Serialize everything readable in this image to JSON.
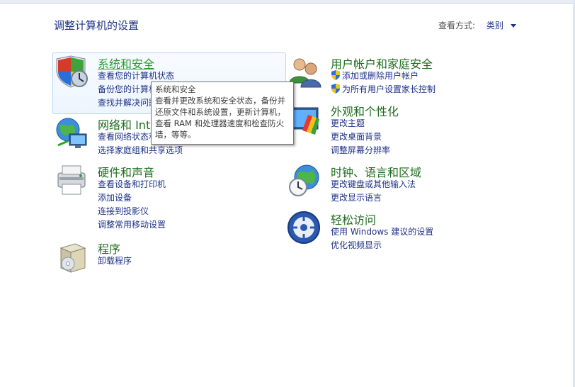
{
  "header": {
    "title": "调整计算机的设置",
    "view_by_label": "查看方式:",
    "view_by_value": "类别"
  },
  "categories": {
    "system_security": {
      "title": "系统和安全",
      "links": [
        "查看您的计算机状态",
        "备份您的计算机",
        "查找并解决问题"
      ]
    },
    "network": {
      "title": "网络和 Internet",
      "links": [
        "查看网络状态和任务",
        "选择家庭组和共享选项"
      ]
    },
    "hardware": {
      "title": "硬件和声音",
      "links": [
        "查看设备和打印机",
        "添加设备",
        "连接到投影仪",
        "调整常用移动设置"
      ]
    },
    "programs": {
      "title": "程序",
      "links": [
        "卸载程序"
      ]
    },
    "users": {
      "title": "用户帐户和家庭安全",
      "links": [
        "添加或删除用户帐户",
        "为所有用户设置家长控制"
      ]
    },
    "appearance": {
      "title": "外观和个性化",
      "links": [
        "更改主题",
        "更改桌面背景",
        "调整屏幕分辨率"
      ]
    },
    "clock": {
      "title": "时钟、语言和区域",
      "links": [
        "更改键盘或其他输入法",
        "更改显示语言"
      ]
    },
    "ease": {
      "title": "轻松访问",
      "links": [
        "使用 Windows 建议的设置",
        "优化视频显示"
      ]
    }
  },
  "tooltip": {
    "title": "系统和安全",
    "body_lines": [
      "查看并更改系统和安全状态，备份并",
      "还原文件和系统设置，更新计算机，",
      "查看 RAM 和处理器速度和检查防火",
      "墙，等等。"
    ]
  }
}
